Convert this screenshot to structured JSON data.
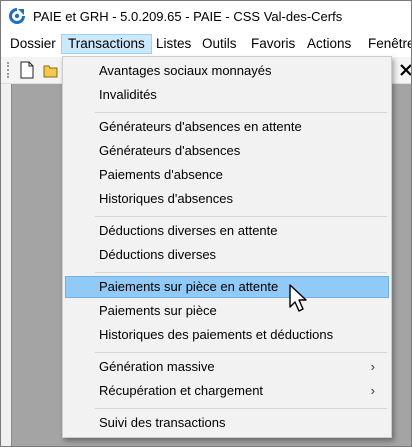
{
  "window": {
    "title": "PAIE et GRH - 5.0.209.65 - PAIE - CSS Val-des-Cerfs",
    "icon": "app-logo-icon"
  },
  "menubar": {
    "items": [
      {
        "label": "Dossier",
        "active": false
      },
      {
        "label": "Transactions",
        "active": true
      },
      {
        "label": "Listes",
        "active": false
      },
      {
        "label": "Outils",
        "active": false
      },
      {
        "label": "Favoris",
        "active": false
      },
      {
        "label": "Actions",
        "active": false
      },
      {
        "label": "Fenêtre",
        "active": false
      }
    ]
  },
  "toolbar": {
    "icons": [
      "new-document-icon",
      "open-folder-icon",
      "close-x-icon"
    ]
  },
  "dropdown": {
    "groups": [
      [
        "Avantages sociaux monnayés",
        "Invalidités"
      ],
      [
        "Générateurs d'absences en attente",
        "Générateurs d'absences",
        "Paiements d'absence",
        "Historiques d'absences"
      ],
      [
        "Déductions diverses en attente",
        "Déductions diverses"
      ],
      [
        "Paiements sur pièce en attente",
        "Paiements sur pièce",
        "Historiques des paiements et déductions"
      ],
      [
        "Génération massive",
        "Récupération et chargement"
      ],
      [
        "Suivi des transactions"
      ]
    ],
    "highlighted": "Paiements sur pièce en attente",
    "submenu_items": [
      "Génération massive",
      "Récupération et chargement"
    ],
    "submenu_arrow": "›"
  },
  "colors": {
    "highlight": "#91c9f7",
    "menu_active": "#cce8ff",
    "workspace": "#a4a4a4",
    "brand": "#1f6fc5"
  }
}
